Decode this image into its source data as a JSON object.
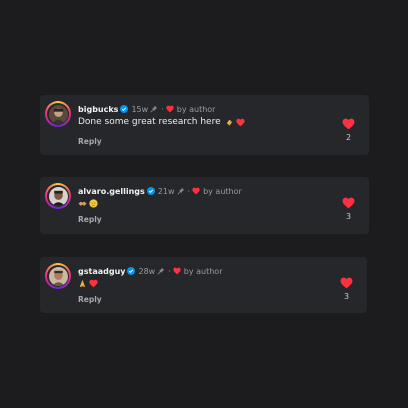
{
  "colors": {
    "background": "#1c1c1e",
    "card": "#26272b",
    "heart": "#ff3040",
    "verified": "#0095f6"
  },
  "comments": [
    {
      "username": "bigbucks",
      "time": "15w",
      "by_author": "by author",
      "text": "Done some great research here",
      "emojis": [
        "clapping-hands",
        "red-heart"
      ],
      "reply_label": "Reply",
      "likes": "2"
    },
    {
      "username": "alvaro.gellings",
      "time": "21w",
      "by_author": "by author",
      "text": "",
      "emojis": [
        "handshake",
        "relieved-face"
      ],
      "reply_label": "Reply",
      "likes": "3"
    },
    {
      "username": "gstaadguy",
      "time": "28w",
      "by_author": "by author",
      "text": "",
      "emojis": [
        "folded-hands",
        "red-heart"
      ],
      "reply_label": "Reply",
      "likes": "3"
    }
  ]
}
